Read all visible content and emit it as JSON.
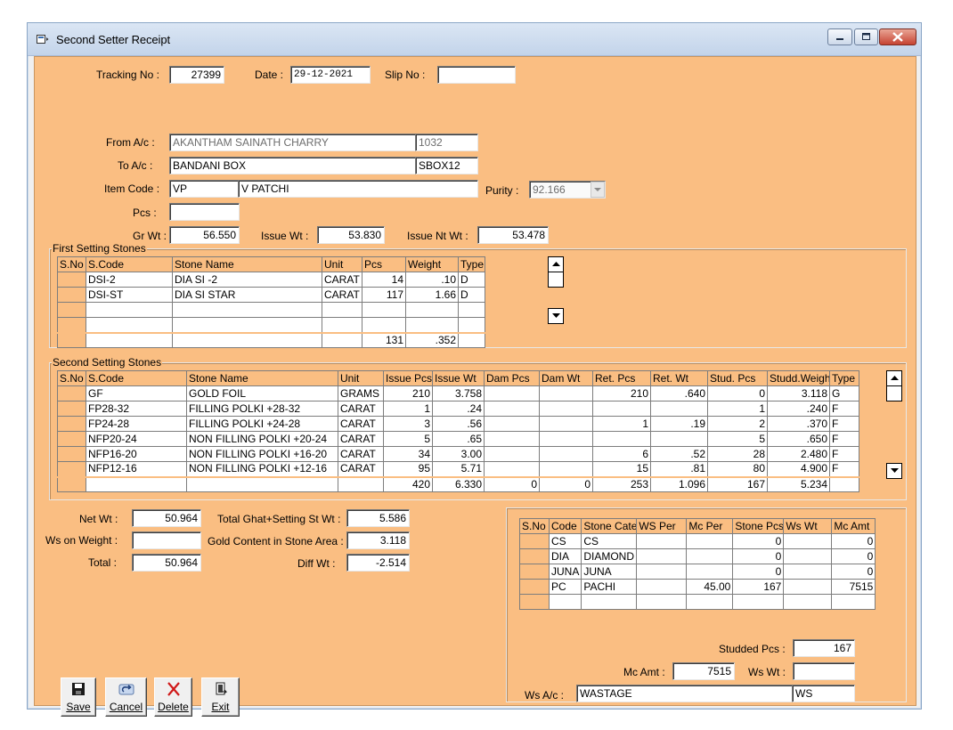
{
  "window": {
    "title": "Second Setter Receipt"
  },
  "header": {
    "tracking_label": "Tracking No :",
    "tracking_no": "27399",
    "date_label": "Date :",
    "date": "29-12-2021",
    "slip_label": "Slip No :",
    "slip_no": "",
    "from_label": "From A/c :",
    "from_name": "AKANTHAM SAINATH CHARRY",
    "from_code": "1032",
    "to_label": "To A/c :",
    "to_name": "BANDANI BOX",
    "to_code": "SBOX12",
    "item_label": "Item Code :",
    "item_code": "VP",
    "item_name": "V PATCHI",
    "purity_label": "Purity :",
    "purity": "92.166",
    "pcs_label": "Pcs :",
    "pcs": "",
    "grwt_label": "Gr Wt :",
    "grwt": "56.550",
    "issuewt_label": "Issue Wt :",
    "issuewt": "53.830",
    "issuentwt_label": "Issue Nt Wt :",
    "issuentwt": "53.478"
  },
  "first_setting": {
    "title": "First Setting Stones",
    "columns": [
      "S.No",
      "S.Code",
      "Stone Name",
      "Unit",
      "Pcs",
      "Weight",
      "Type"
    ],
    "rows": [
      [
        "",
        "DSI-2",
        "DIA SI -2",
        "CARAT",
        "14",
        ".10",
        "D"
      ],
      [
        "",
        "DSI-ST",
        "DIA SI STAR",
        "CARAT",
        "117",
        "1.66",
        "D"
      ],
      [
        "",
        "",
        "",
        "",
        "",
        "",
        ""
      ],
      [
        "",
        "",
        "",
        "",
        "",
        "",
        ""
      ]
    ],
    "total": [
      "",
      "",
      "",
      "",
      "131",
      ".352",
      ""
    ]
  },
  "second_setting": {
    "title": "Second Setting Stones",
    "columns": [
      "S.No",
      "S.Code",
      "Stone Name",
      "Unit",
      "Issue Pcs",
      "Issue Wt",
      "Dam Pcs",
      "Dam Wt",
      "Ret. Pcs",
      "Ret. Wt",
      "Stud. Pcs",
      "Studd.Weight",
      "Type"
    ],
    "rows": [
      [
        "",
        "GF",
        "GOLD FOIL",
        "GRAMS",
        "210",
        "3.758",
        "",
        "",
        "210",
        ".640",
        "0",
        "3.118",
        "G"
      ],
      [
        "",
        "FP28-32",
        "FILLING POLKI +28-32",
        "CARAT",
        "1",
        ".24",
        "",
        "",
        "",
        "",
        "1",
        ".240",
        "F"
      ],
      [
        "",
        "FP24-28",
        "FILLING POLKI +24-28",
        "CARAT",
        "3",
        ".56",
        "",
        "",
        "1",
        ".19",
        "2",
        ".370",
        "F"
      ],
      [
        "",
        "NFP20-24",
        "NON FILLING POLKI +20-24",
        "CARAT",
        "5",
        ".65",
        "",
        "",
        "",
        "",
        "5",
        ".650",
        "F"
      ],
      [
        "",
        "NFP16-20",
        "NON FILLING POLKI +16-20",
        "CARAT",
        "34",
        "3.00",
        "",
        "",
        "6",
        ".52",
        "28",
        "2.480",
        "F"
      ],
      [
        "",
        "NFP12-16",
        "NON FILLING POLKI +12-16",
        "CARAT",
        "95",
        "5.71",
        "",
        "",
        "15",
        ".81",
        "80",
        "4.900",
        "F"
      ]
    ],
    "total": [
      "",
      "",
      "",
      "",
      "420",
      "6.330",
      "0",
      "0",
      "253",
      "1.096",
      "167",
      "5.234",
      ""
    ]
  },
  "summary": {
    "netwt_label": "Net Wt :",
    "netwt": "50.964",
    "wsonwt_label": "Ws on Weight :",
    "wsonwt": "",
    "total_label": "Total :",
    "total": "50.964",
    "ghat_label": "Total Ghat+Setting St Wt :",
    "ghat": "5.586",
    "goldcontent_label": "Gold Content in Stone Area :",
    "goldcontent": "3.118",
    "diff_label": "Diff Wt :",
    "diff": "-2.514"
  },
  "category": {
    "columns": [
      "S.No",
      "Code",
      "Stone Cate",
      "WS Per",
      "Mc Per",
      "Stone Pcs",
      "Ws Wt",
      "Mc Amt"
    ],
    "rows": [
      [
        "",
        "CS",
        "CS",
        "",
        "",
        "0",
        "",
        "0"
      ],
      [
        "",
        "DIA",
        "DIAMOND",
        "",
        "",
        "0",
        "",
        "0"
      ],
      [
        "",
        "JUNA",
        "JUNA",
        "",
        "",
        "0",
        "",
        "0"
      ],
      [
        "",
        "PC",
        "PACHI",
        "",
        "45.00",
        "167",
        "",
        "7515"
      ],
      [
        "",
        "",
        "",
        "",
        "",
        "",
        "",
        ""
      ]
    ]
  },
  "footer": {
    "studded_label": "Studded Pcs :",
    "studded": "167",
    "mcamt_label": "Mc Amt :",
    "mcamt": "7515",
    "wswt_label": "Ws Wt :",
    "wswt": "",
    "wsac_label": "Ws A/c :",
    "wsac_name": "WASTAGE",
    "wsac_code": "WS"
  },
  "toolbar": {
    "save": "Save",
    "cancel": "Cancel",
    "delete": "Delete",
    "exit": "Exit"
  },
  "colors": {
    "form_bg": "#fabe82",
    "window_frame": "#c3d4ea",
    "close_red": "#c64332"
  },
  "icons": [
    "app-icon",
    "minimize-icon",
    "maximize-icon",
    "close-icon",
    "save-icon",
    "cancel-icon",
    "delete-icon",
    "exit-icon",
    "scroll-up-icon",
    "scroll-down-icon",
    "combo-arrow-icon"
  ]
}
